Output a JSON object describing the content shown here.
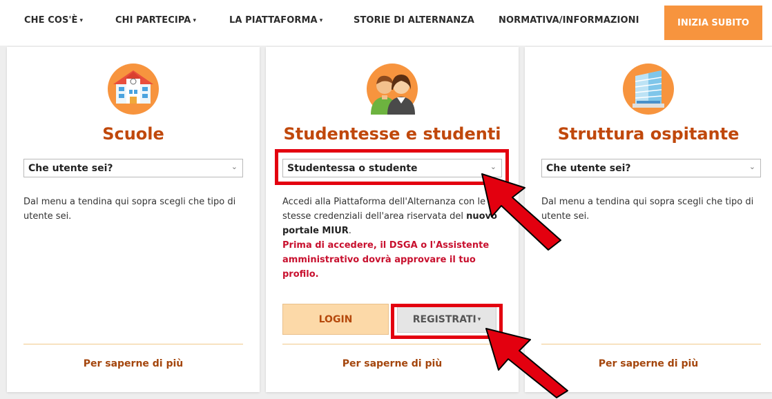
{
  "nav": {
    "items": [
      {
        "label": "CHE COS'È",
        "dropdown": true
      },
      {
        "label": "CHI PARTECIPA",
        "dropdown": true
      },
      {
        "label": "LA PIATTAFORMA",
        "dropdown": true
      },
      {
        "label": "STORIE DI ALTERNANZA",
        "dropdown": false
      },
      {
        "label": "NORMATIVA/INFORMAZIONI",
        "dropdown": false
      }
    ],
    "cta": "INIZIA SUBITO",
    "caret": "▾"
  },
  "cards": {
    "scuole": {
      "title": "Scuole",
      "select_value": "Che utente sei?",
      "description": "Dal menu a tendina qui sopra scegli che tipo di utente sei.",
      "more": "Per saperne di più",
      "icon": "school-icon"
    },
    "studenti": {
      "title": "Studentesse e studenti",
      "select_value": "Studentessa o studente",
      "desc_part1": "Accedi alla Piattaforma dell'Alternanza con le stesse credenziali dell'area riservata del ",
      "desc_bold": "nuovo portale MIUR",
      "desc_end": ".",
      "warning": "Prima di accedere, il DSGA o l'Assistente amministrativo dovrà approvare il tuo profilo.",
      "login": "LOGIN",
      "register": "REGISTRATI",
      "more": "Per saperne di più",
      "icon": "students-icon"
    },
    "struttura": {
      "title": "Struttura ospitante",
      "select_value": "Che utente sei?",
      "description": "Dal menu a tendina qui sopra scegli che tipo di utente sei.",
      "more": "Per saperne di più",
      "icon": "building-icon"
    }
  },
  "colors": {
    "accent": "#f7943e",
    "title": "#c0480b",
    "warning": "#c8102e",
    "highlight": "#e3000f"
  }
}
